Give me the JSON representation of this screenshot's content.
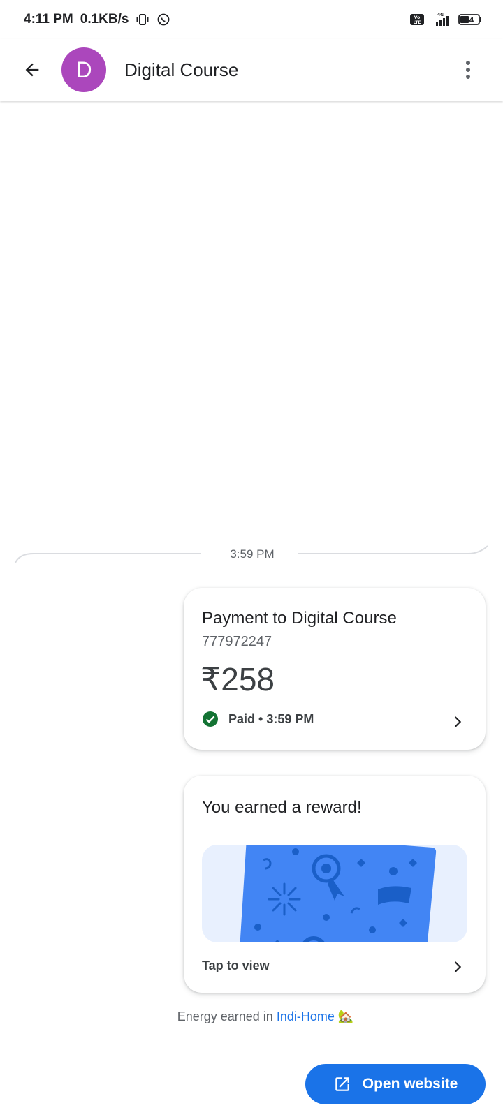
{
  "status_bar": {
    "time": "4:11 PM",
    "network_speed": "0.1KB/s",
    "network_type": "4G",
    "battery": "44",
    "icons": [
      "vibrate-icon",
      "whatsapp-icon",
      "volte-icon",
      "signal-icon",
      "battery-icon"
    ]
  },
  "header": {
    "avatar_letter": "D",
    "title": "Digital Course",
    "avatar_color": "#ab47bc"
  },
  "chat": {
    "timestamp": "3:59 PM",
    "payment": {
      "title": "Payment to Digital Course",
      "number": "777972247",
      "amount": "₹258",
      "status": "Paid • 3:59 PM",
      "status_color": "#137333"
    },
    "reward": {
      "title": "You earned a reward!",
      "action": "Tap to view"
    },
    "energy": {
      "prefix": "Energy earned in ",
      "link": "Indi-Home",
      "emoji": "🏡"
    }
  },
  "footer": {
    "open_website_label": "Open website",
    "button_color": "#1a73e8"
  }
}
